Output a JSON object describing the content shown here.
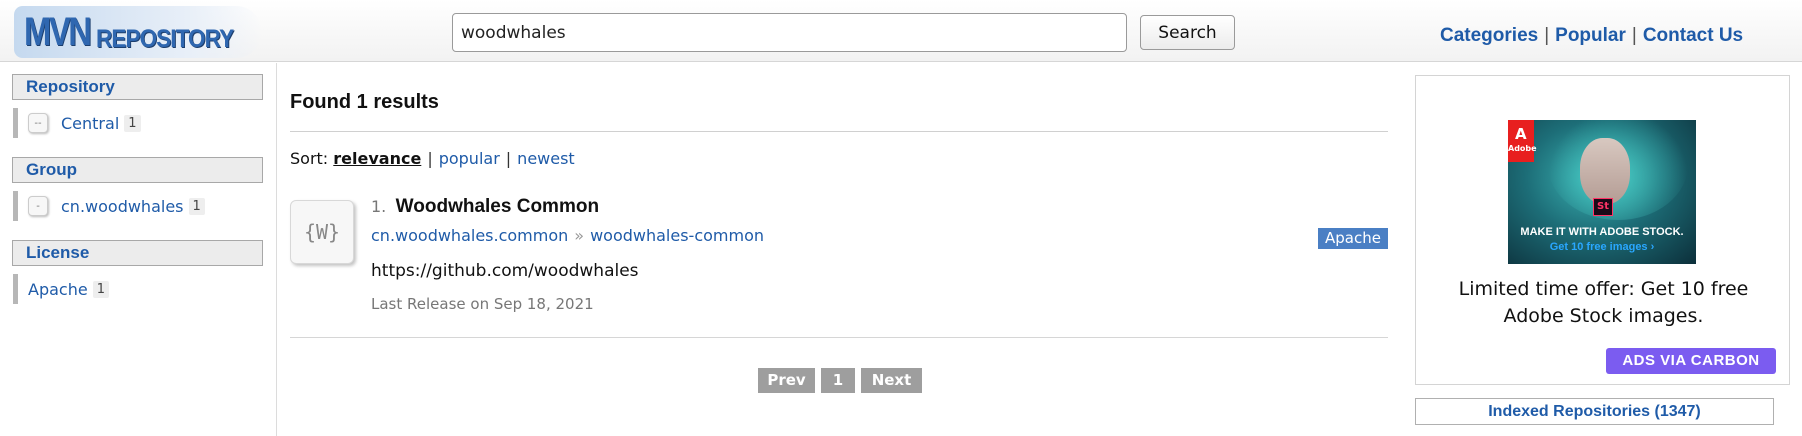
{
  "header": {
    "logo_mvn": "MVN",
    "logo_repository": "REPOSITORY",
    "search_value": "woodwhales",
    "search_button": "Search",
    "nav": [
      "Categories",
      "Popular",
      "Contact Us"
    ],
    "nav_separator": "|"
  },
  "sidebar": {
    "sections": [
      {
        "title": "Repository",
        "items": [
          {
            "label": "Central",
            "count": "1",
            "icon": "--"
          }
        ]
      },
      {
        "title": "Group",
        "items": [
          {
            "label": "cn.woodwhales",
            "count": "1",
            "icon": "-"
          }
        ]
      },
      {
        "title": "License",
        "items": [
          {
            "label": "Apache",
            "count": "1"
          }
        ]
      }
    ]
  },
  "main": {
    "found": "Found 1 results",
    "sort": {
      "label": "Sort:",
      "options": [
        "relevance",
        "popular",
        "newest"
      ],
      "active": "relevance",
      "separator": "|"
    },
    "results": [
      {
        "icon_text": "{W}",
        "number": "1.",
        "title": "Woodwhales Common",
        "group": "cn.woodwhales.common",
        "arrow": "»",
        "artifact": "woodwhales-common",
        "license": "Apache",
        "url": "https://github.com/woodwhales",
        "last_release": "Last Release on Sep 18, 2021"
      }
    ],
    "pagination": {
      "prev": "Prev",
      "page": "1",
      "next": "Next"
    }
  },
  "right": {
    "ad": {
      "adobe_logo": "A",
      "adobe_label": "Adobe",
      "stock_badge": "St",
      "image_line1": "MAKE IT WITH ADOBE STOCK.",
      "image_line2": "Get 10 free images ›",
      "text": "Limited time offer: Get 10 free Adobe Stock images.",
      "via": "ADS VIA CARBON"
    },
    "indexed": "Indexed Repositories (1347)"
  },
  "colors": {
    "link": "#1f5ba8",
    "badge": "#4a7fc4",
    "carbon": "#7b5cf0",
    "pager": "#9e9e9e"
  }
}
